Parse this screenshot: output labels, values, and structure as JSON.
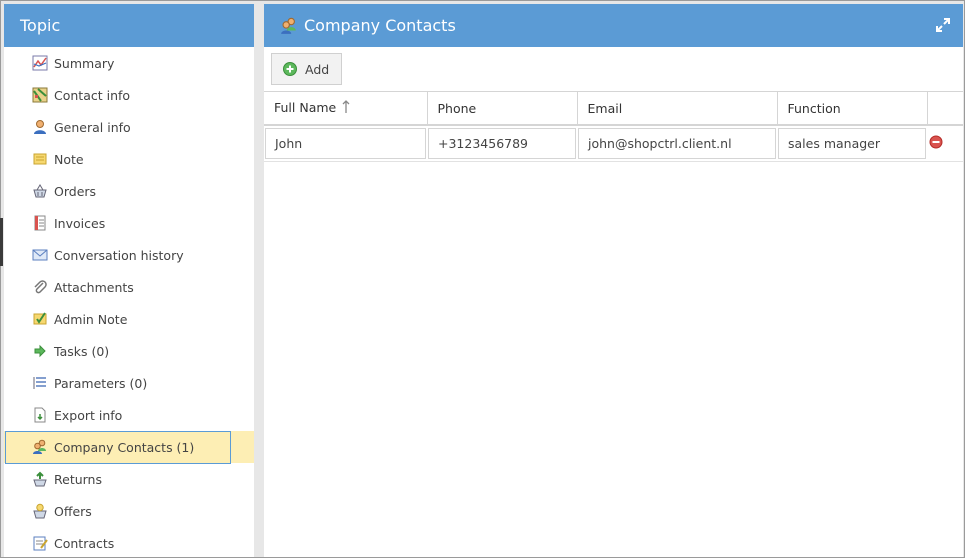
{
  "sidebar": {
    "title": "Topic",
    "items": [
      {
        "label": "Summary",
        "icon": "chart-icon"
      },
      {
        "label": "Contact info",
        "icon": "map-icon"
      },
      {
        "label": "General info",
        "icon": "person-icon"
      },
      {
        "label": "Note",
        "icon": "note-icon"
      },
      {
        "label": "Orders",
        "icon": "basket-icon"
      },
      {
        "label": "Invoices",
        "icon": "invoice-icon"
      },
      {
        "label": "Conversation history",
        "icon": "envelope-icon"
      },
      {
        "label": "Attachments",
        "icon": "paperclip-icon"
      },
      {
        "label": "Admin Note",
        "icon": "admin-note-icon"
      },
      {
        "label": "Tasks (0)",
        "icon": "arrow-right-icon"
      },
      {
        "label": "Parameters (0)",
        "icon": "list-icon"
      },
      {
        "label": "Export info",
        "icon": "export-icon"
      },
      {
        "label": "Company Contacts (1)",
        "icon": "contacts-icon",
        "active": true
      },
      {
        "label": "Returns",
        "icon": "returns-icon"
      },
      {
        "label": "Offers",
        "icon": "offers-icon"
      },
      {
        "label": "Contracts",
        "icon": "contract-icon"
      }
    ]
  },
  "main": {
    "title": "Company Contacts",
    "add_label": "Add",
    "columns": [
      "Full Name",
      "Phone",
      "Email",
      "Function"
    ],
    "rows": [
      {
        "full_name": "John",
        "phone": "+3123456789",
        "email": "john@shopctrl.client.nl",
        "function": "sales manager"
      }
    ]
  },
  "colors": {
    "header_blue": "#5b9bd5",
    "active_item": "#fdeeb4",
    "delete_red": "#d9534f",
    "add_green": "#5cb85c"
  }
}
